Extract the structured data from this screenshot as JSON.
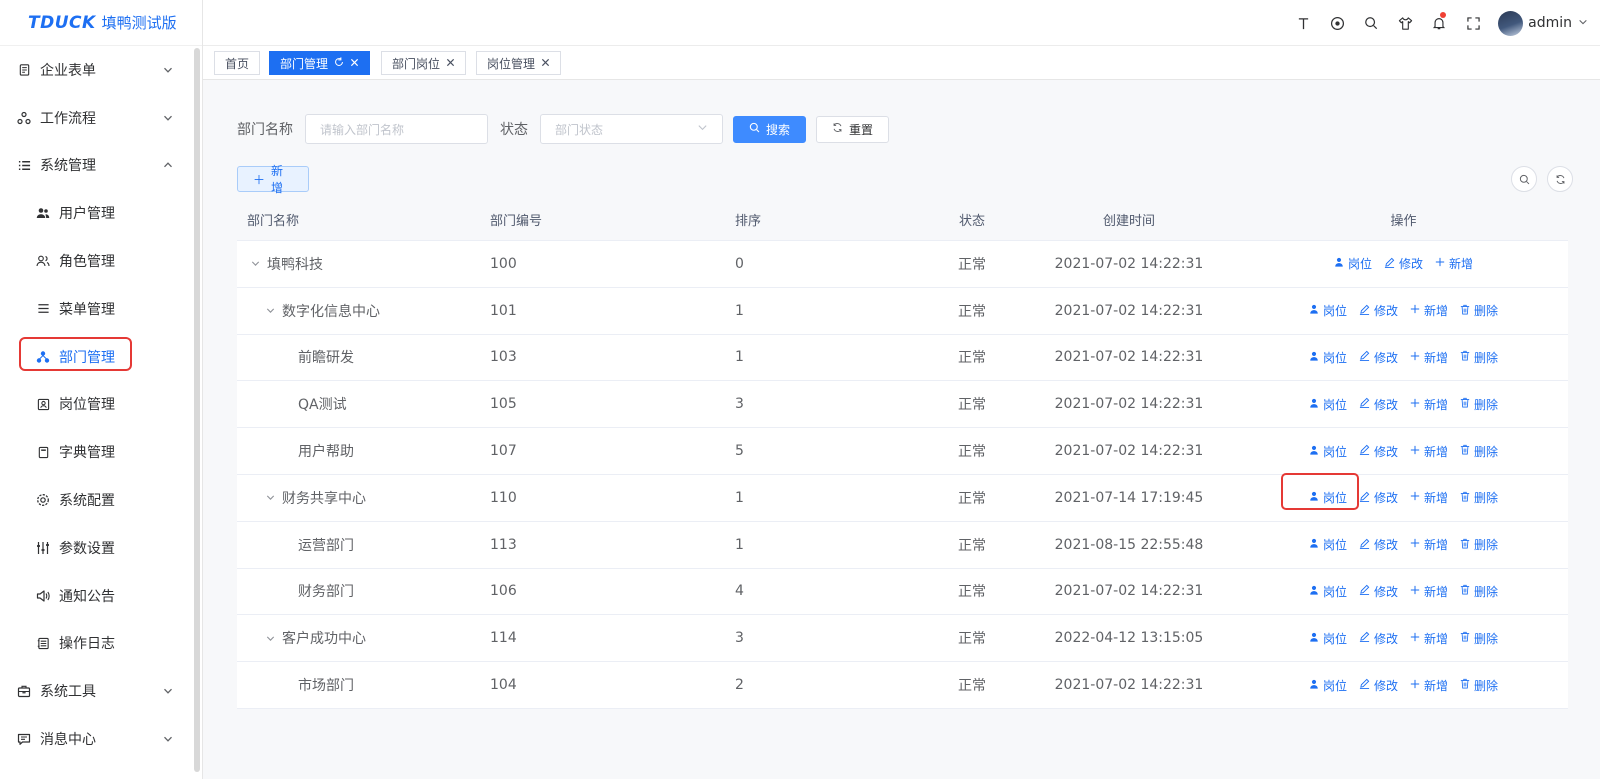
{
  "app": {
    "logo": "TDUCK",
    "title": "填鸭测试版"
  },
  "header": {
    "username": "admin"
  },
  "sidebar": {
    "items": [
      {
        "label": "企业表单",
        "icon": "form-icon",
        "expandable": true,
        "expanded": false
      },
      {
        "label": "工作流程",
        "icon": "workflow-icon",
        "expandable": true,
        "expanded": false
      },
      {
        "label": "系统管理",
        "icon": "list-icon",
        "expandable": true,
        "expanded": true
      }
    ],
    "sub_items": [
      {
        "label": "用户管理",
        "icon": "users-icon"
      },
      {
        "label": "角色管理",
        "icon": "role-icon"
      },
      {
        "label": "菜单管理",
        "icon": "menu-icon"
      },
      {
        "label": "部门管理",
        "icon": "dept-icon",
        "active": true
      },
      {
        "label": "岗位管理",
        "icon": "post-icon"
      },
      {
        "label": "字典管理",
        "icon": "dict-icon"
      },
      {
        "label": "系统配置",
        "icon": "gear-icon"
      },
      {
        "label": "参数设置",
        "icon": "sliders-icon"
      },
      {
        "label": "通知公告",
        "icon": "speaker-icon"
      },
      {
        "label": "操作日志",
        "icon": "log-icon"
      }
    ],
    "bottom_items": [
      {
        "label": "系统工具",
        "icon": "toolbox-icon"
      },
      {
        "label": "消息中心",
        "icon": "message-icon"
      }
    ]
  },
  "tags": [
    {
      "label": "首页",
      "active": false,
      "closable": false
    },
    {
      "label": "部门管理",
      "active": true,
      "closable": true
    },
    {
      "label": "部门岗位",
      "active": false,
      "closable": true
    },
    {
      "label": "岗位管理",
      "active": false,
      "closable": true
    }
  ],
  "search": {
    "name_label": "部门名称",
    "name_placeholder": "请输入部门名称",
    "status_label": "状态",
    "status_placeholder": "部门状态",
    "search_button": "搜索",
    "reset_button": "重置",
    "add_button": "新增"
  },
  "table": {
    "columns": [
      "部门名称",
      "部门编号",
      "排序",
      "状态",
      "创建时间",
      "操作"
    ],
    "ops": {
      "post": "岗位",
      "edit": "修改",
      "add": "新增",
      "delete": "删除"
    },
    "rows": [
      {
        "name": "填鸭科技",
        "id": "100",
        "order": "0",
        "status": "正常",
        "created": "2021-07-02 14:22:31",
        "level": 0,
        "expandable": true,
        "deletable": false
      },
      {
        "name": "数字化信息中心",
        "id": "101",
        "order": "1",
        "status": "正常",
        "created": "2021-07-02 14:22:31",
        "level": 1,
        "expandable": true,
        "deletable": true
      },
      {
        "name": "前瞻研发",
        "id": "103",
        "order": "1",
        "status": "正常",
        "created": "2021-07-02 14:22:31",
        "level": 2,
        "expandable": false,
        "deletable": true
      },
      {
        "name": "QA测试",
        "id": "105",
        "order": "3",
        "status": "正常",
        "created": "2021-07-02 14:22:31",
        "level": 2,
        "expandable": false,
        "deletable": true
      },
      {
        "name": "用户帮助",
        "id": "107",
        "order": "5",
        "status": "正常",
        "created": "2021-07-02 14:22:31",
        "level": 2,
        "expandable": false,
        "deletable": true
      },
      {
        "name": "财务共享中心",
        "id": "110",
        "order": "1",
        "status": "正常",
        "created": "2021-07-14 17:19:45",
        "level": 1,
        "expandable": true,
        "deletable": true,
        "highlight": true
      },
      {
        "name": "运营部门",
        "id": "113",
        "order": "1",
        "status": "正常",
        "created": "2021-08-15 22:55:48",
        "level": 2,
        "expandable": false,
        "deletable": true
      },
      {
        "name": "财务部门",
        "id": "106",
        "order": "4",
        "status": "正常",
        "created": "2021-07-02 14:22:31",
        "level": 2,
        "expandable": false,
        "deletable": true
      },
      {
        "name": "客户成功中心",
        "id": "114",
        "order": "3",
        "status": "正常",
        "created": "2022-04-12 13:15:05",
        "level": 1,
        "expandable": true,
        "deletable": true
      },
      {
        "name": "市场部门",
        "id": "104",
        "order": "2",
        "status": "正常",
        "created": "2021-07-02 14:22:31",
        "level": 2,
        "expandable": false,
        "deletable": true
      }
    ]
  },
  "colors": {
    "primary": "#1d6ff2",
    "highlight": "#e53935"
  }
}
